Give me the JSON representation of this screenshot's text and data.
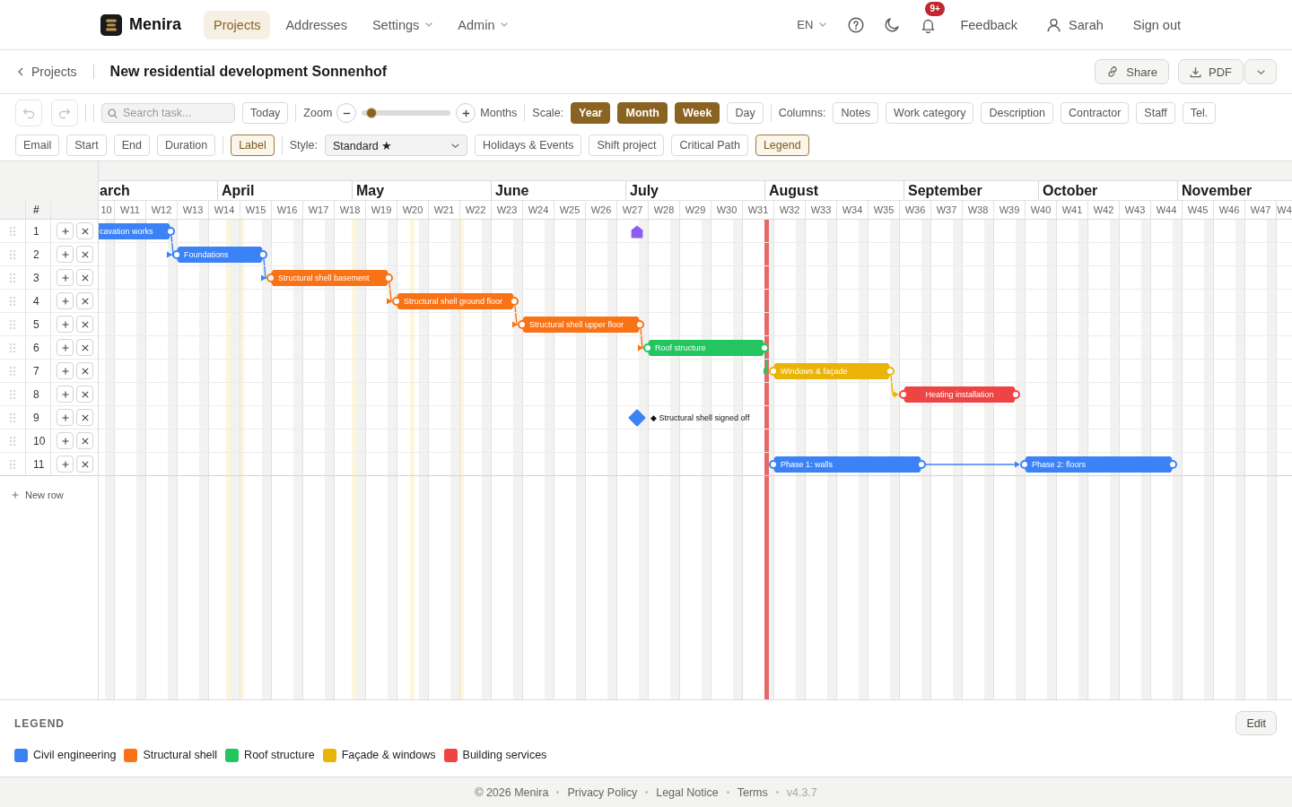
{
  "header": {
    "brand": "Menira",
    "nav": [
      {
        "label": "Projects",
        "selected": true,
        "has_menu": false
      },
      {
        "label": "Addresses",
        "selected": false,
        "has_menu": false
      },
      {
        "label": "Settings",
        "selected": false,
        "has_menu": true
      },
      {
        "label": "Admin",
        "selected": false,
        "has_menu": true
      }
    ],
    "language": "EN",
    "notification_badge": "9+",
    "feedback": "Feedback",
    "user": "Sarah",
    "sign_out": "Sign out"
  },
  "page_bar": {
    "back": "Projects",
    "title": "New residential development Sonnenhof",
    "share": "Share",
    "pdf": "PDF"
  },
  "toolbar": {
    "undo": {
      "disabled": true
    },
    "redo": {
      "disabled": true
    },
    "search": {
      "placeholder": "Search task..."
    },
    "today": "Today",
    "zoom_label": "Zoom",
    "zoom": {
      "level": 0.05
    },
    "zoom_unit": "Months",
    "scale_label": "Scale:",
    "scales": [
      {
        "label": "Year",
        "on": true
      },
      {
        "label": "Month",
        "on": true
      },
      {
        "label": "Week",
        "on": true
      },
      {
        "label": "Day",
        "on": false
      }
    ],
    "columns_label": "Columns:",
    "columns": [
      {
        "label": "Notes",
        "on": false
      },
      {
        "label": "Work category",
        "on": false
      },
      {
        "label": "Description",
        "on": false
      },
      {
        "label": "Contractor",
        "on": false
      },
      {
        "label": "Staff",
        "on": false
      },
      {
        "label": "Tel.",
        "on": false
      }
    ],
    "fields": [
      {
        "label": "Email",
        "on": false
      },
      {
        "label": "Start",
        "on": false
      },
      {
        "label": "End",
        "on": false
      },
      {
        "label": "Duration",
        "on": false
      }
    ],
    "label_toggle": {
      "label": "Label",
      "on": true
    },
    "style_label": "Style:",
    "style": "Standard ★",
    "options": [
      {
        "label": "Holidays & Events",
        "on": false
      },
      {
        "label": "Shift project",
        "on": false
      },
      {
        "label": "Critical Path",
        "on": false
      },
      {
        "label": "Legend",
        "on": true
      }
    ]
  },
  "gantt": {
    "index_header": "#",
    "months": [
      "arch",
      "April",
      "May",
      "June",
      "July",
      "August",
      "September",
      "October",
      "November"
    ],
    "weeks": [
      "10",
      "W11",
      "W12",
      "W13",
      "W14",
      "W15",
      "W16",
      "W17",
      "W18",
      "W19",
      "W20",
      "W21",
      "W22",
      "W23",
      "W24",
      "W25",
      "W26",
      "W27",
      "W28",
      "W29",
      "W30",
      "W31",
      "W32",
      "W33",
      "W34",
      "W35",
      "W36",
      "W37",
      "W38",
      "W39",
      "W40",
      "W41",
      "W42",
      "W43",
      "W44",
      "W45",
      "W46",
      "W47",
      "W4"
    ],
    "rows": [
      {
        "number": "1",
        "items": [
          {
            "kind": "bar",
            "label": "cavation works",
            "color": "#3b82f6",
            "linked": false
          },
          {
            "kind": "marker",
            "color": "#8b5cf6"
          }
        ]
      },
      {
        "number": "2",
        "items": [
          {
            "kind": "bar",
            "label": "Foundations",
            "color": "#3b82f6",
            "linked": true
          }
        ]
      },
      {
        "number": "3",
        "items": [
          {
            "kind": "bar",
            "label": "Structural shell basement",
            "color": "#f97316",
            "linked": true
          }
        ]
      },
      {
        "number": "4",
        "items": [
          {
            "kind": "bar",
            "label": "Structural shell ground floor",
            "color": "#f97316",
            "linked": true
          }
        ]
      },
      {
        "number": "5",
        "items": [
          {
            "kind": "bar",
            "label": "Structural shell upper floor",
            "color": "#f97316",
            "linked": true
          }
        ]
      },
      {
        "number": "6",
        "items": [
          {
            "kind": "bar",
            "label": "Roof structure",
            "color": "#22c55e",
            "linked": true
          }
        ]
      },
      {
        "number": "7",
        "items": [
          {
            "kind": "bar",
            "label": "Windows & façade",
            "color": "#eab308",
            "linked": true
          }
        ]
      },
      {
        "number": "8",
        "items": [
          {
            "kind": "bar",
            "label": "Heating installation",
            "color": "#ef4444",
            "linked": true
          }
        ]
      },
      {
        "number": "9",
        "items": [
          {
            "kind": "milestone",
            "label": "◆ Structural shell signed off",
            "color": "#3b82f6"
          }
        ]
      },
      {
        "number": "10"
      },
      {
        "number": "11",
        "items": [
          {
            "kind": "bar",
            "label": "Phase 1: walls",
            "color": "#3b82f6",
            "linked": false
          },
          {
            "kind": "bar",
            "label": "Phase 2: floors",
            "color": "#3b82f6",
            "linked": true
          }
        ]
      }
    ],
    "new_row": "New row"
  },
  "legend": {
    "title": "LEGEND",
    "edit": "Edit",
    "items": [
      {
        "label": "Civil engineering",
        "color": "#3b82f6"
      },
      {
        "label": "Structural shell",
        "color": "#f97316"
      },
      {
        "label": "Roof structure",
        "color": "#22c55e"
      },
      {
        "label": "Façade & windows",
        "color": "#eab308"
      },
      {
        "label": "Building services",
        "color": "#ef4444"
      }
    ]
  },
  "footer": {
    "copyright": "© 2026 Menira",
    "links": [
      "Privacy Policy",
      "Legal Notice",
      "Terms"
    ],
    "version": "v4.3.7"
  }
}
